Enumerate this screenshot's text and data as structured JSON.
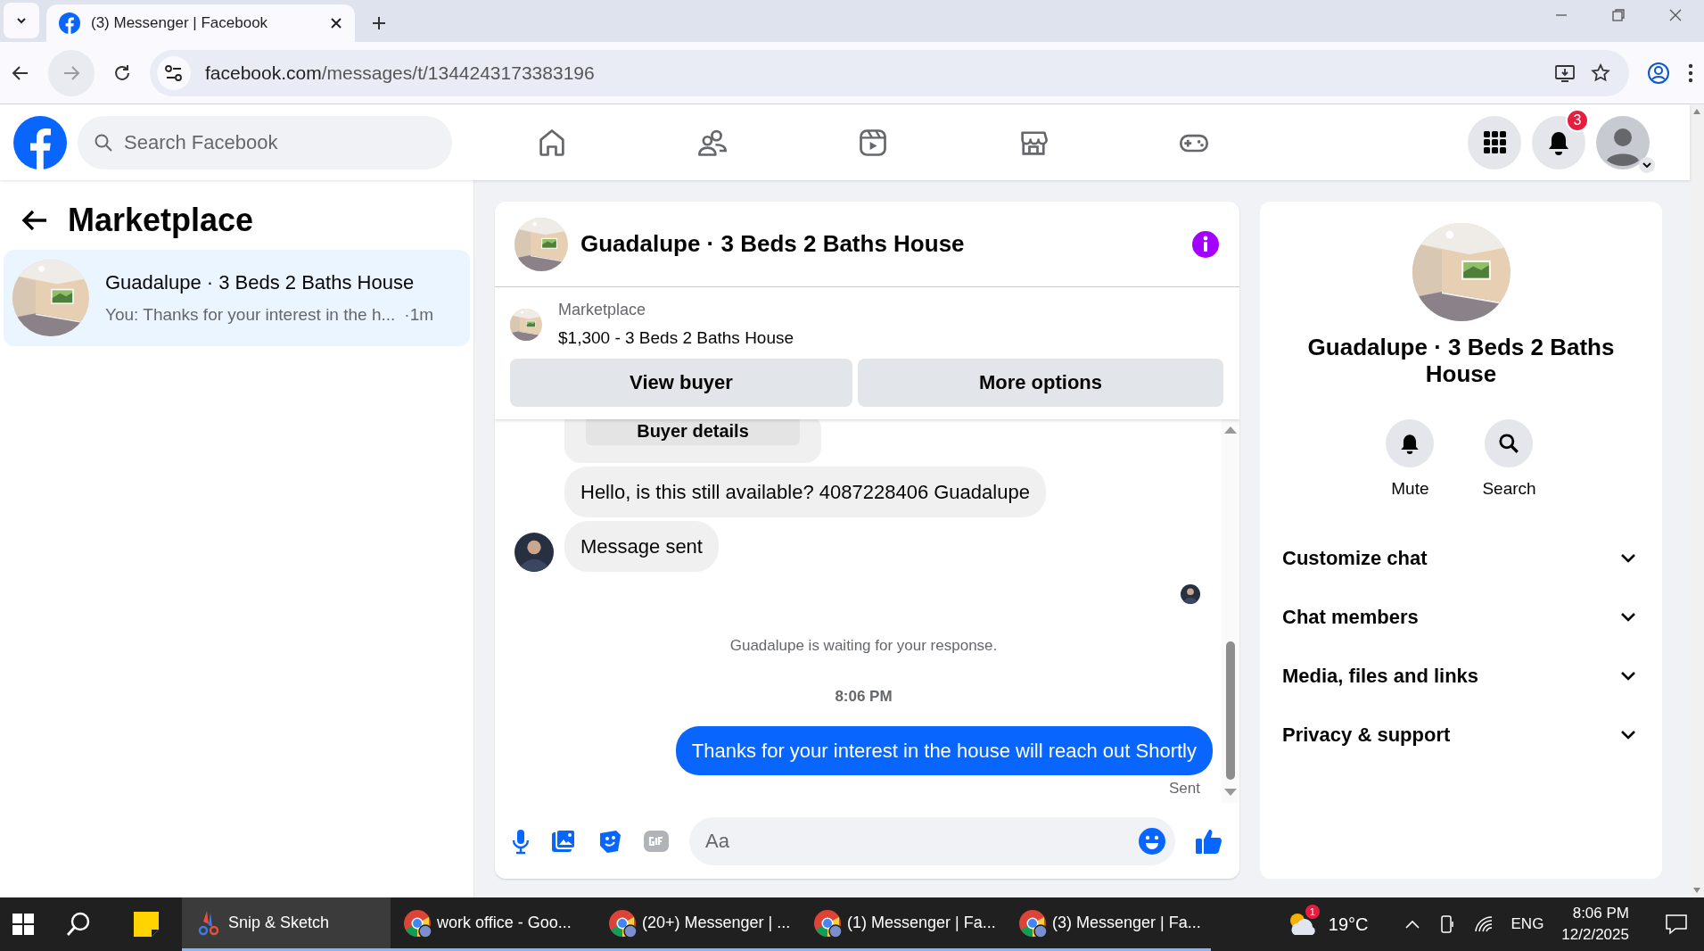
{
  "browser": {
    "tab_title": "(3) Messenger | Facebook",
    "url_domain": "facebook.com",
    "url_path": "/messages/t/1344243173383196"
  },
  "header": {
    "search": {
      "placeholder": "Search Facebook"
    },
    "nav": [
      {
        "kind": "home"
      },
      {
        "kind": "friends"
      },
      {
        "kind": "video"
      },
      {
        "kind": "marketplace"
      },
      {
        "kind": "gaming"
      }
    ],
    "notification_count": "3"
  },
  "sidebar": {
    "title": "Marketplace",
    "conversations": [
      {
        "title": "Guadalupe · 3 Beds 2 Baths House",
        "preview": "You: Thanks for your interest in the h...",
        "time": "·1m",
        "selected": true
      }
    ]
  },
  "chat": {
    "title": "Guadalupe · 3 Beds 2 Baths House",
    "listing": {
      "source": "Marketplace",
      "summary": "$1,300 - 3 Beds 2 Baths House"
    },
    "buttons": [
      "View buyer",
      "More options"
    ],
    "messages": [
      {
        "kind": "action",
        "text": "Buyer details"
      },
      {
        "kind": "incoming",
        "text": "Hello, is this still available? 4087228406 Guadalupe",
        "show_avatar": false
      },
      {
        "kind": "incoming",
        "text": "Message sent",
        "show_avatar": true
      },
      {
        "kind": "read_receipt"
      },
      {
        "kind": "status",
        "text": "Guadalupe is waiting for your response."
      },
      {
        "kind": "timestamp",
        "text": "8:06 PM"
      },
      {
        "kind": "outgoing",
        "text": "Thanks for your interest in the house will reach out Shortly"
      },
      {
        "kind": "delivery",
        "text": "Sent"
      }
    ],
    "composer": {
      "placeholder": "Aa"
    }
  },
  "details": {
    "title": "Guadalupe · 3 Beds 2 Baths House",
    "actions": [
      {
        "kind": "mute",
        "label": "Mute"
      },
      {
        "kind": "search",
        "label": "Search"
      }
    ],
    "sections": [
      {
        "label": "Customize chat",
        "expanded": false
      },
      {
        "label": "Chat members",
        "expanded": false
      },
      {
        "label": "Media, files and links",
        "expanded": false
      },
      {
        "label": "Privacy & support",
        "expanded": false
      }
    ]
  },
  "taskbar": {
    "apps": [
      {
        "label": "Snip & Sketch",
        "kind": "snip",
        "selected": true
      },
      {
        "label": "work office - Goo...",
        "kind": "chrome",
        "selected": false
      },
      {
        "label": "(20+) Messenger | ...",
        "kind": "chrome",
        "selected": false
      },
      {
        "label": "(1) Messenger | Fa...",
        "kind": "chrome",
        "selected": false
      },
      {
        "label": "(3) Messenger | Fa...",
        "kind": "chrome",
        "selected": false
      }
    ],
    "weather": {
      "temperature": "19°C",
      "badge": "1"
    },
    "language": "ENG",
    "time": "8:06 PM",
    "date": "12/2/2025"
  }
}
